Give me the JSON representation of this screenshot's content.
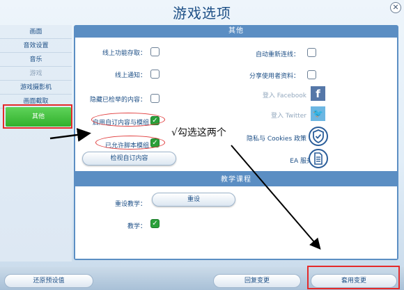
{
  "title": "游戏选项",
  "sidebar": {
    "items": [
      {
        "label": "画面"
      },
      {
        "label": "音效设置"
      },
      {
        "label": "音乐"
      },
      {
        "label": "游戏"
      },
      {
        "label": "游戏摄影机"
      },
      {
        "label": "画面截取"
      },
      {
        "label": "其他"
      }
    ]
  },
  "panel_other": {
    "header": "其他",
    "left_options": [
      {
        "label": "线上功能存取：",
        "checked": false
      },
      {
        "label": "线上通知：",
        "checked": false
      },
      {
        "label": "隐藏已检举的内容：",
        "checked": false
      },
      {
        "label": "启用自订内容与模组",
        "checked": true
      },
      {
        "label": "已允许脚本模组",
        "checked": true
      }
    ],
    "right_options": [
      {
        "label": "自动重新连线：",
        "checked": false
      },
      {
        "label": "分享使用者资料：",
        "checked": false
      }
    ],
    "links": [
      {
        "label": "登入 Facebook",
        "icon": "facebook-icon"
      },
      {
        "label": "登入 Twitter",
        "icon": "twitter-icon"
      },
      {
        "label": "隐私与 Cookies 政策",
        "icon": "shield-check-icon"
      },
      {
        "label": "EA 服务条款",
        "icon": "document-icon"
      }
    ],
    "view_custom_button": "检视自订内容"
  },
  "panel_tutorial": {
    "header": "教学课程",
    "reset_label": "重设教学：",
    "reset_button": "重设",
    "tutorial_label": "教学：",
    "tutorial_checked": true
  },
  "annotation": "√勾选这两个",
  "footer": {
    "restore_defaults": "还原预设值",
    "undo_changes": "回复变更",
    "apply_changes": "套用变更"
  },
  "colors": {
    "accent_green": "#31b02c",
    "panel_blue": "#5b8ec3",
    "text_blue": "#1d4f86",
    "highlight_red": "#e42a2a"
  }
}
